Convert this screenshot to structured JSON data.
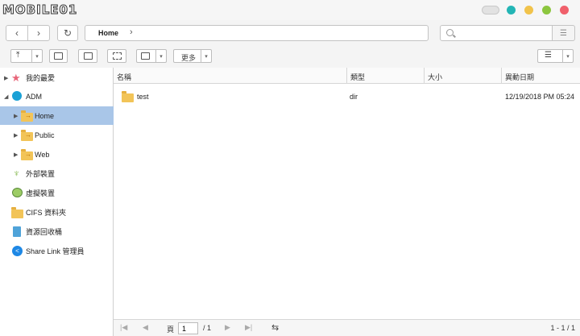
{
  "window": {
    "logo_text": "MOBILE01",
    "controls": {
      "colors": [
        "#23b5b5",
        "#f1c34b",
        "#8cc63f",
        "#f0606b"
      ]
    }
  },
  "nav": {
    "back_icon": "chevron-left-icon",
    "forward_icon": "chevron-right-icon",
    "refresh_icon": "refresh-icon",
    "breadcrumb": "Home",
    "search_placeholder": ""
  },
  "toolbar": {
    "more_label": "更多"
  },
  "sidebar": {
    "favorites": "我的最愛",
    "adm": "ADM",
    "home": "Home",
    "public": "Public",
    "web": "Web",
    "external": "外部裝置",
    "virtual": "虛擬裝置",
    "cifs": "CIFS 資料夾",
    "recycle": "資源回收桶",
    "sharelink": "Share Link 管理員"
  },
  "table": {
    "columns": [
      "名稱",
      "類型",
      "大小",
      "異動日期"
    ],
    "rows": [
      {
        "name": "test",
        "type": "dir",
        "size": "",
        "modified": "12/19/2018 PM 05:24"
      }
    ]
  },
  "pager": {
    "page_label": "頁",
    "page_value": "1",
    "total": "/ 1",
    "range": "1 - 1 / 1"
  }
}
